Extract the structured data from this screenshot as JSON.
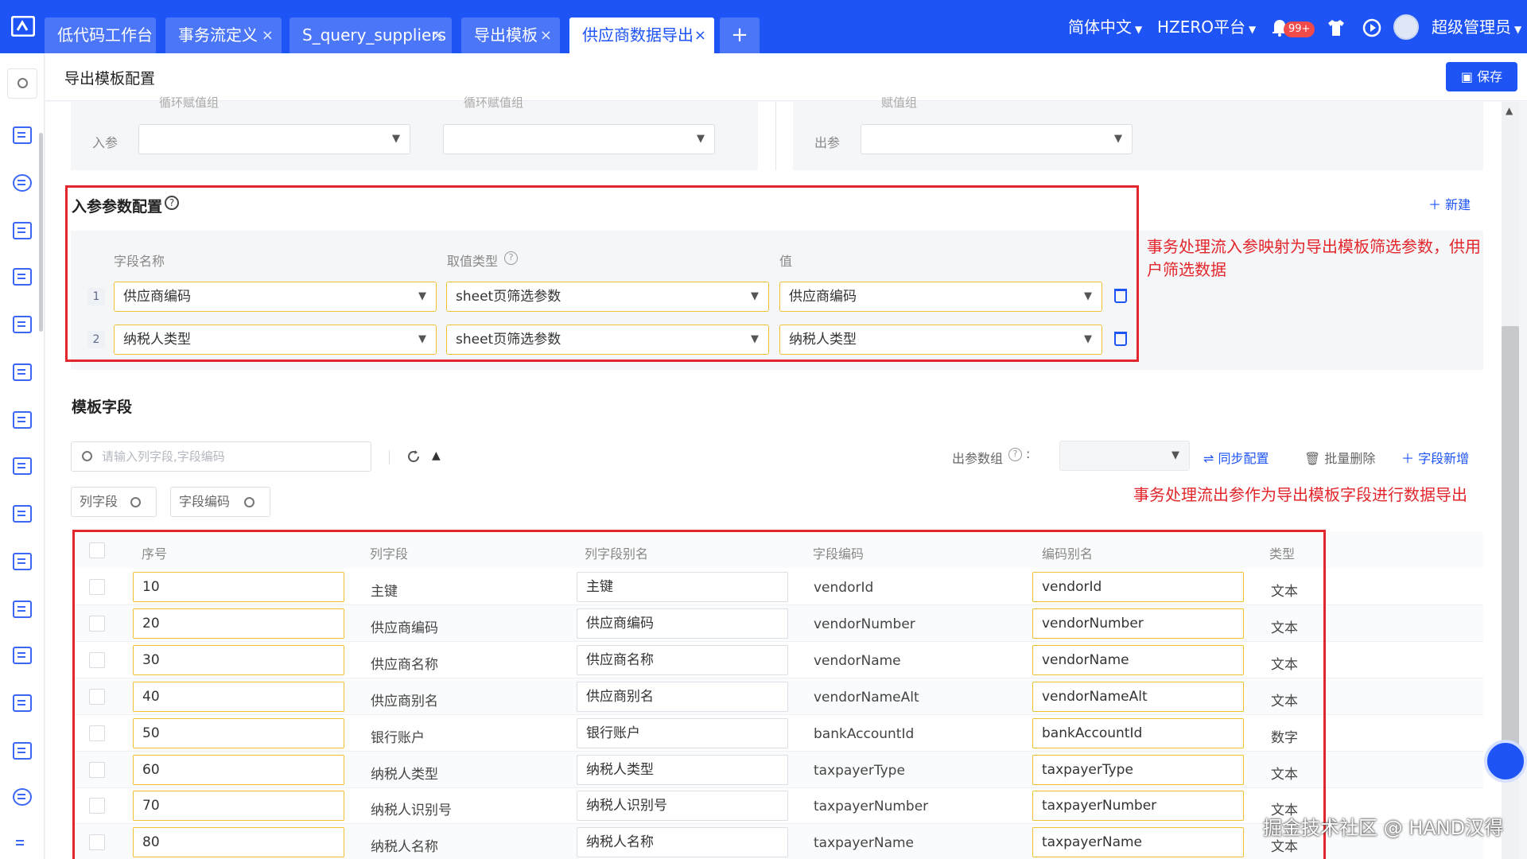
{
  "topbar": {
    "tabs": [
      {
        "label": "低代码工作台",
        "closable": false
      },
      {
        "label": "事务流定义",
        "closable": true
      },
      {
        "label": "S_query_suppliers",
        "closable": true
      },
      {
        "label": "导出模板",
        "closable": true
      },
      {
        "label": "供应商数据导出",
        "closable": true,
        "active": true
      }
    ],
    "add_tab": "+",
    "language": "简体中文",
    "platform": "HZERO平台",
    "notification_count": "99+",
    "user": "超级管理员"
  },
  "sidebar": {
    "icons": [
      "search-icon",
      "code-icon",
      "network-icon",
      "code-icon",
      "code-icon",
      "mail-settings-icon",
      "folder-settings-icon",
      "list-icon",
      "form-icon",
      "chart-settings-icon",
      "export-icon",
      "table-icon",
      "layout-icon",
      "component-icon",
      "image-icon",
      "plugin-icon",
      "menu-icon"
    ]
  },
  "header": {
    "title": "导出模板配置",
    "save_label": "保存"
  },
  "top_section": {
    "in_param_label": "入参",
    "out_param_label": "出参",
    "partial_labels": [
      "循环赋值组",
      "循环赋值组",
      "赋值组"
    ]
  },
  "in_params": {
    "title": "入参参数配置",
    "new_label": "新建",
    "columns": [
      "字段名称",
      "取值类型",
      "值"
    ],
    "rows": [
      {
        "no": "1",
        "field": "供应商编码",
        "type": "sheet页筛选参数",
        "value": "供应商编码"
      },
      {
        "no": "2",
        "field": "纳税人类型",
        "type": "sheet页筛选参数",
        "value": "纳税人类型"
      }
    ],
    "annotation": "事务处理流入参映射为导出模板筛选参数，供用户筛选数据"
  },
  "template_fields": {
    "title": "模板字段",
    "search_placeholder": "请输入列字段,字段编码",
    "out_group_label": "出参数组",
    "out_group_suffix": ":",
    "sync_label": "同步配置",
    "batch_delete_label": "批量删除",
    "add_field_label": "字段新增",
    "filters": [
      "列字段",
      "字段编码"
    ],
    "annotation": "事务处理流出参作为导出模板字段进行数据导出",
    "columns": [
      "序号",
      "列字段",
      "列字段别名",
      "字段编码",
      "编码别名",
      "类型"
    ],
    "rows": [
      {
        "seq": "10",
        "col": "主键",
        "alias": "主键",
        "code": "vendorId",
        "code_alias": "vendorId",
        "type": "文本"
      },
      {
        "seq": "20",
        "col": "供应商编码",
        "alias": "供应商编码",
        "code": "vendorNumber",
        "code_alias": "vendorNumber",
        "type": "文本"
      },
      {
        "seq": "30",
        "col": "供应商名称",
        "alias": "供应商名称",
        "code": "vendorName",
        "code_alias": "vendorName",
        "type": "文本"
      },
      {
        "seq": "40",
        "col": "供应商别名",
        "alias": "供应商别名",
        "code": "vendorNameAlt",
        "code_alias": "vendorNameAlt",
        "type": "文本"
      },
      {
        "seq": "50",
        "col": "银行账户",
        "alias": "银行账户",
        "code": "bankAccountId",
        "code_alias": "bankAccountId",
        "type": "数字"
      },
      {
        "seq": "60",
        "col": "纳税人类型",
        "alias": "纳税人类型",
        "code": "taxpayerType",
        "code_alias": "taxpayerType",
        "type": "文本"
      },
      {
        "seq": "70",
        "col": "纳税人识别号",
        "alias": "纳税人识别号",
        "code": "taxpayerNumber",
        "code_alias": "taxpayerNumber",
        "type": "文本"
      },
      {
        "seq": "80",
        "col": "纳税人名称",
        "alias": "纳税人名称",
        "code": "taxpayerName",
        "code_alias": "taxpayerName",
        "type": "文本"
      }
    ]
  },
  "watermark": "掘金技术社区 @ HAND汉得",
  "colors": {
    "primary": "#1e54f5",
    "annotation_red": "#e2262b",
    "input_highlight": "#f0c030"
  }
}
